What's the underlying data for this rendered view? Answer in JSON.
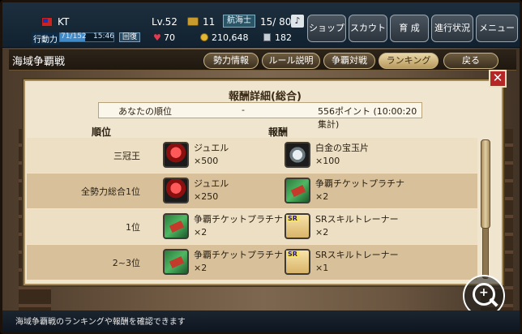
{
  "status": {
    "player_name": "KT",
    "level": "Lv.52",
    "chest_count": "11",
    "rank_badge": "航海士",
    "crew": "15/ 80",
    "ap_label": "行動力",
    "ap_value": "71/152",
    "ap_fraction": 0.467,
    "ap_time": "15:46",
    "recover_label": "回復",
    "hearts": "70",
    "money": "210,648",
    "books": "182"
  },
  "nav": [
    "ショップ",
    "スカウト",
    "育 成",
    "進行状況",
    "メニュー"
  ],
  "page": {
    "title": "海域争覇戦",
    "tabs": [
      "勢力情報",
      "ルール説明",
      "争覇対戦",
      "ランキング",
      "戻る"
    ],
    "active_tab": "ランキング"
  },
  "dialog": {
    "title": "報酬詳細(総合)",
    "my_rank_label": "あなたの順位",
    "my_rank_value": "-",
    "my_points": "556ポイント (10:00:20集計)",
    "col_rank": "順位",
    "col_reward": "報酬",
    "close": "✕",
    "rows": [
      {
        "rank": "三冠王",
        "r1_name": "ジュエル",
        "r1_qty": "×500",
        "r2_name": "白金の宝玉片",
        "r2_qty": "×100"
      },
      {
        "rank": "全勢力総合1位",
        "r1_name": "ジュエル",
        "r1_qty": "×250",
        "r2_name": "争覇チケットプラチナ",
        "r2_qty": "×2"
      },
      {
        "rank": "1位",
        "r1_name": "争覇チケットプラチナ",
        "r1_qty": "×2",
        "r2_name": "SRスキルトレーナー",
        "r2_qty": "×2"
      },
      {
        "rank": "2~3位",
        "r1_name": "争覇チケットプラチナ",
        "r1_qty": "×2",
        "r2_name": "SRスキルトレーナー",
        "r2_qty": "×1"
      }
    ],
    "sr_tag": "SR"
  },
  "footer": "海域争覇戦のランキングや報酬を確認できます"
}
